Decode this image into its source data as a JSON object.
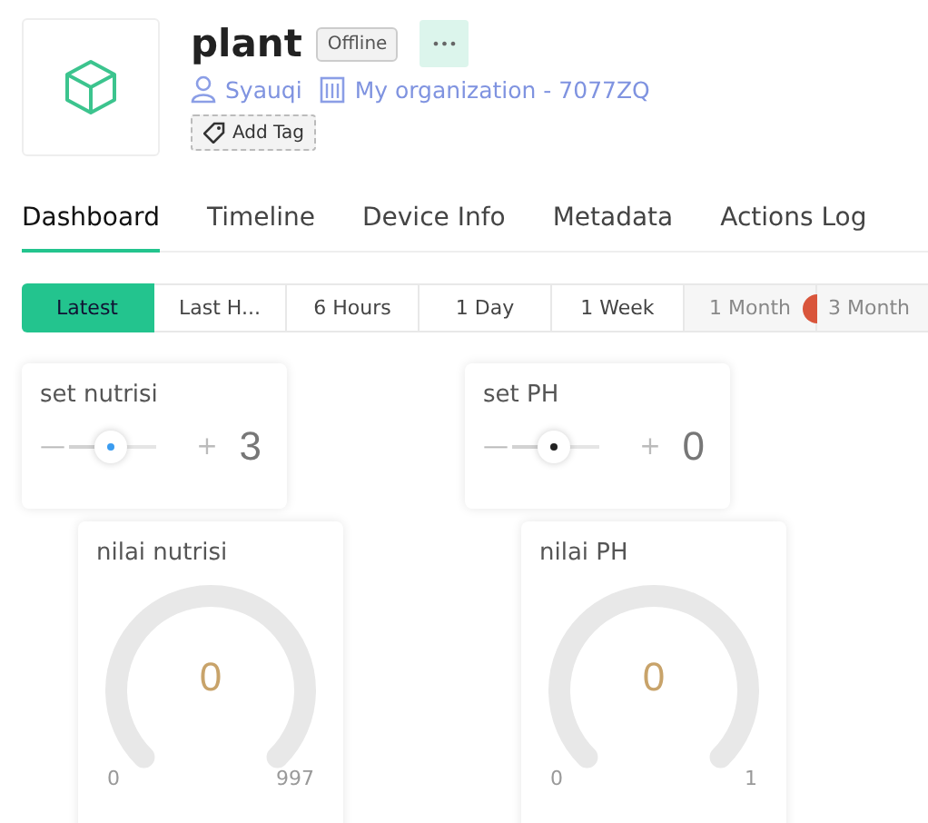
{
  "device": {
    "name": "plant",
    "status": "Offline",
    "owner": "Syauqi",
    "organization": "My organization - 7077ZQ",
    "add_tag": "Add Tag",
    "more": "•••"
  },
  "tabs": [
    {
      "label": "Dashboard",
      "selected": true
    },
    {
      "label": "Timeline",
      "selected": false
    },
    {
      "label": "Device Info",
      "selected": false
    },
    {
      "label": "Metadata",
      "selected": false
    },
    {
      "label": "Actions Log",
      "selected": false
    }
  ],
  "ranges": [
    {
      "label": "Latest",
      "selected": true
    },
    {
      "label": "Last H...",
      "selected": false
    },
    {
      "label": "6 Hours",
      "selected": false
    },
    {
      "label": "1 Day",
      "selected": false
    },
    {
      "label": "1 Week",
      "selected": false
    },
    {
      "label": "1 Month",
      "selected": false,
      "disabled": true
    },
    {
      "label": "3 Month",
      "selected": false,
      "disabled": true
    }
  ],
  "sliders": [
    {
      "title": "set nutrisi",
      "minus": "—",
      "plus": "+",
      "value": "3",
      "level": 0.3,
      "color": "#3b9cf0"
    },
    {
      "title": "set PH",
      "minus": "—",
      "plus": "+",
      "value": "0",
      "level": 0.3,
      "color": "#222222"
    }
  ],
  "gauges": [
    {
      "title": "nilai nutrisi",
      "value": "0",
      "min": "0",
      "max": "997"
    },
    {
      "title": "nilai PH",
      "value": "0",
      "min": "0",
      "max": "1"
    }
  ]
}
